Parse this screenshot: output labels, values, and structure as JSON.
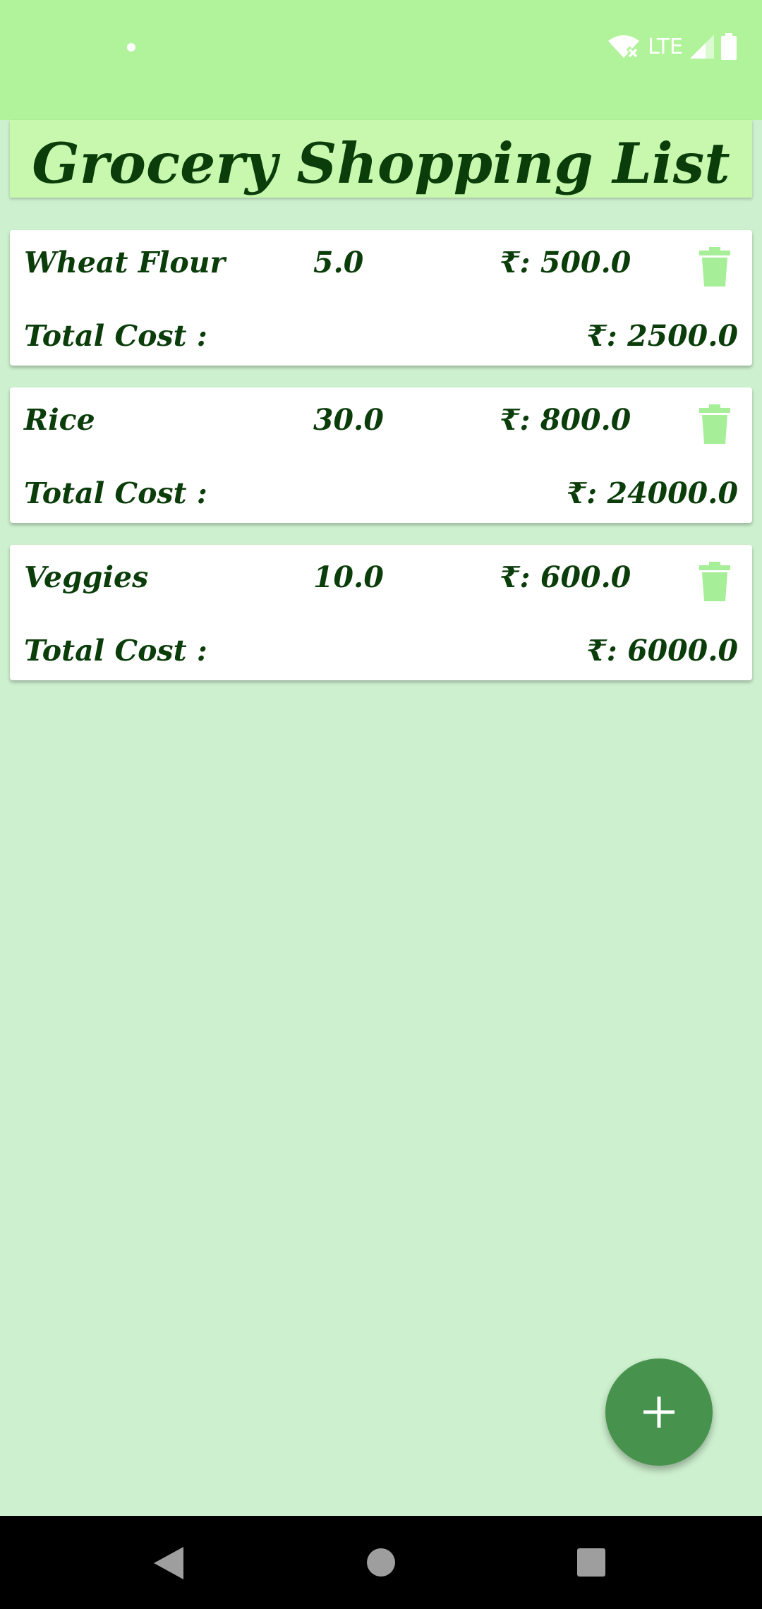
{
  "app": {
    "title": "Grocery Shopping List"
  },
  "status_bar": {
    "network": "LTE",
    "icons": [
      "notification-dot-icon",
      "wifi-off-icon",
      "signal-icon",
      "battery-icon"
    ]
  },
  "items": [
    {
      "name": "Wheat Flour",
      "quantity": "5.0",
      "price": "₹: 500.0",
      "total_label": "Total Cost :",
      "total_value": "₹: 2500.0"
    },
    {
      "name": "Rice",
      "quantity": "30.0",
      "price": "₹: 800.0",
      "total_label": "Total Cost :",
      "total_value": "₹: 24000.0"
    },
    {
      "name": "Veggies",
      "quantity": "10.0",
      "price": "₹: 600.0",
      "total_label": "Total Cost :",
      "total_value": "₹: 6000.0"
    }
  ],
  "fab": {
    "icon": "plus-icon"
  },
  "nav": {
    "icons": [
      "back-icon",
      "home-icon",
      "recents-icon"
    ]
  },
  "colors": {
    "status_bar": "#b1f39a",
    "background": "#cdf0ce",
    "title_box": "#c8f8ae",
    "text": "#0b3d0b",
    "trash_icon": "#a6ee98",
    "fab": "#47934e"
  }
}
